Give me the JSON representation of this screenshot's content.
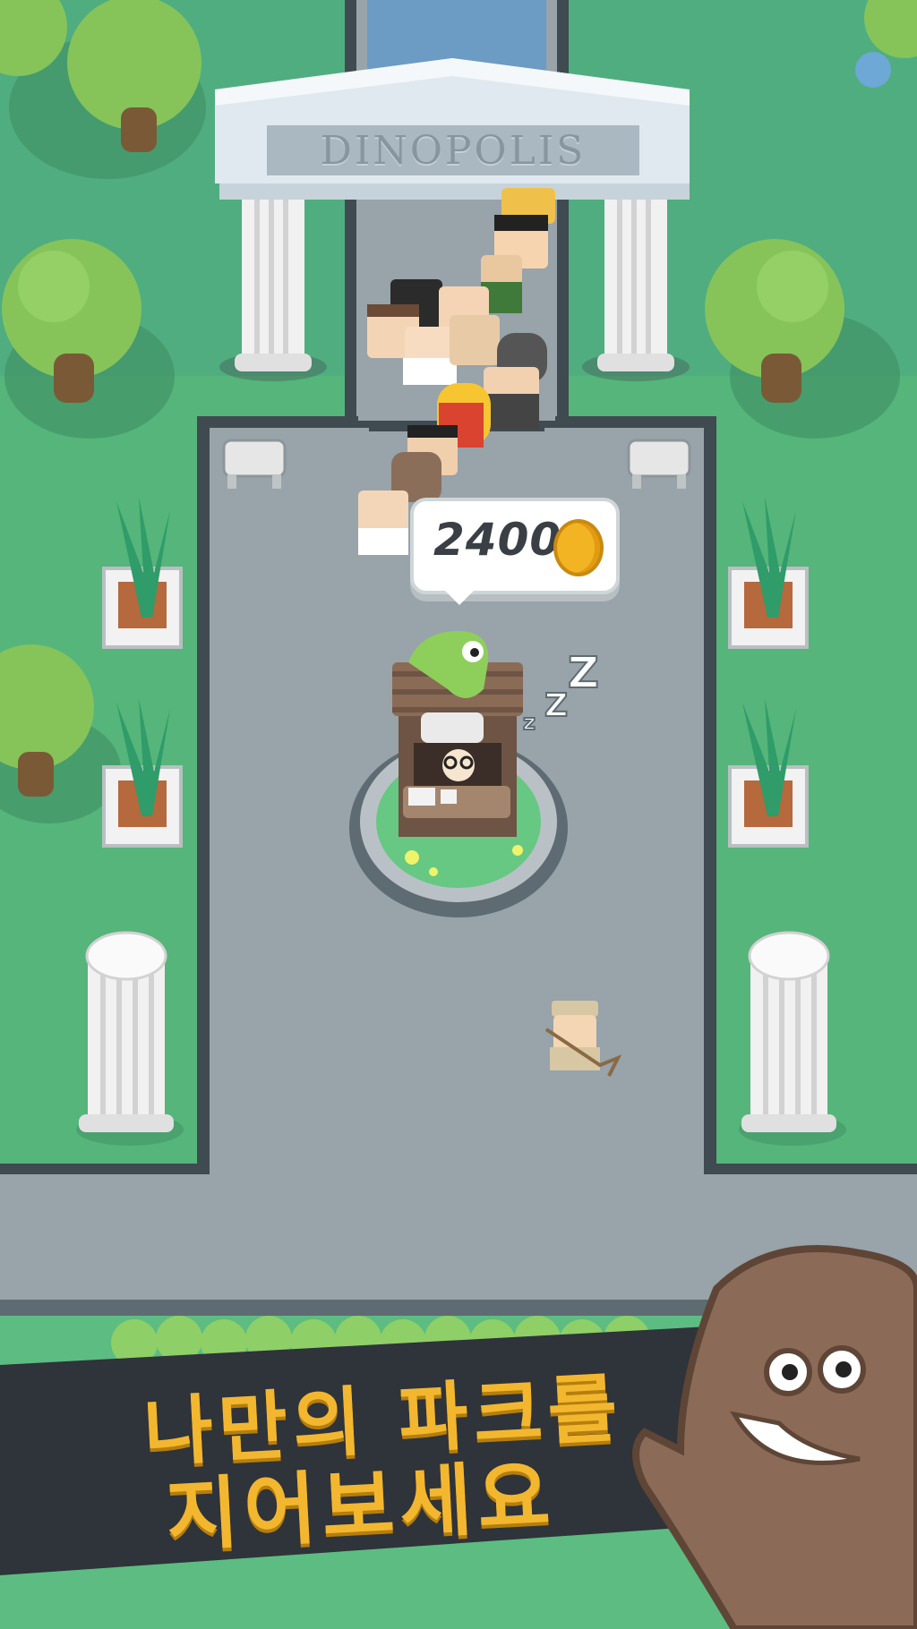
{
  "gate": {
    "title": "DINOPOLIS"
  },
  "ticket_booth": {
    "revenue": "2400",
    "coin_icon": "gold-coin-icon",
    "status_icon": "sleeping-zzz-icon",
    "zzz": [
      "Z",
      "Z",
      "z"
    ]
  },
  "banner": {
    "line1": "나만의 파크를",
    "line2": "지어보세요"
  },
  "colors": {
    "grass": "#56b57a",
    "path": "#96a1a8",
    "wall": "#5e6b72",
    "banner": "#2f333a",
    "banner_text": "#f3b72f",
    "coin": "#f3b423"
  }
}
